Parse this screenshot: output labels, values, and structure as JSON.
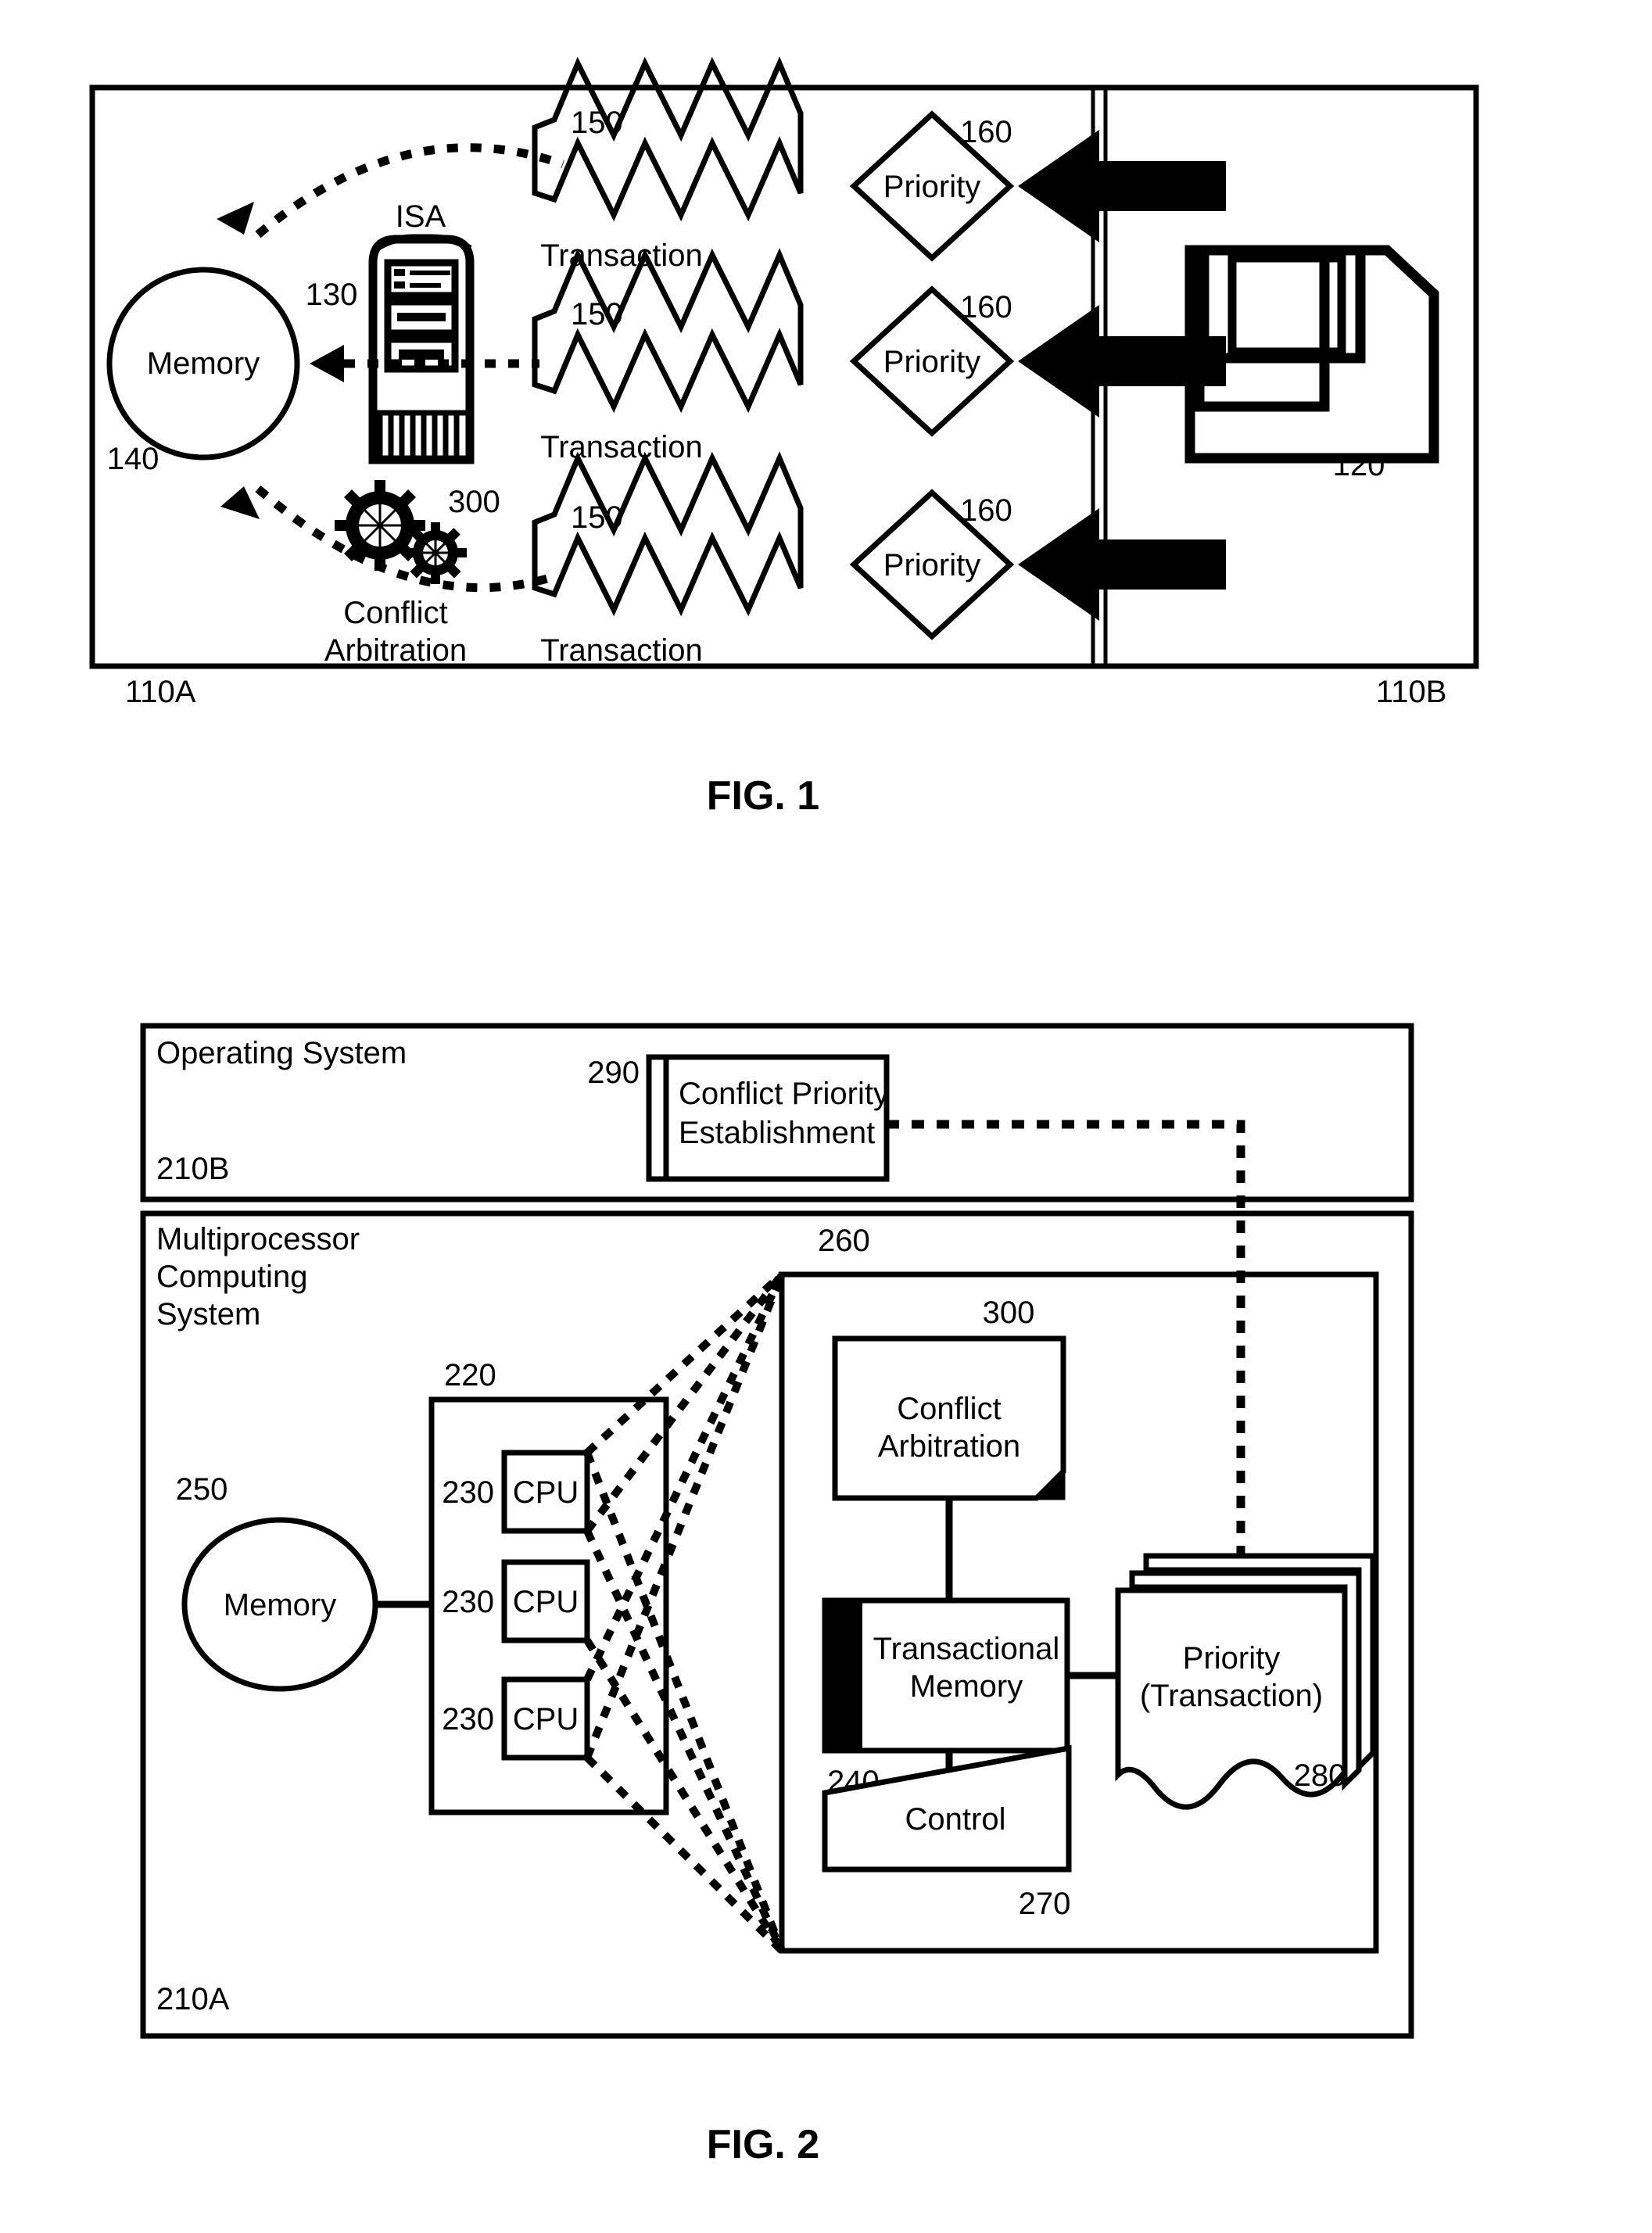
{
  "figures": [
    {
      "id": "fig1",
      "caption": "FIG. 1",
      "left_panel_ref": "110A",
      "right_panel_ref": "110B",
      "nodes": {
        "memory": {
          "label": "Memory",
          "ref": "140"
        },
        "isa": {
          "label": "ISA",
          "ref": "130"
        },
        "conflict_arbitration": {
          "label_line1": "Conflict",
          "label_line2": "Arbitration",
          "ref": "300"
        },
        "storage": {
          "ref": "120",
          "icon": "floppy-disk-icon"
        }
      },
      "rows": [
        {
          "transaction_label": "Transaction",
          "transaction_ref": "150",
          "priority_label": "Priority",
          "priority_ref": "160"
        },
        {
          "transaction_label": "Transaction",
          "transaction_ref": "150",
          "priority_label": "Priority",
          "priority_ref": "160"
        },
        {
          "transaction_label": "Transaction",
          "transaction_ref": "150",
          "priority_label": "Priority",
          "priority_ref": "160"
        }
      ]
    },
    {
      "id": "fig2",
      "caption": "FIG. 2",
      "os_panel": {
        "title": "Operating System",
        "ref": "210B"
      },
      "conflict_priority_establishment": {
        "line1": "Conflict Priority",
        "line2": "Establishment",
        "ref": "290"
      },
      "mp_panel": {
        "title_line1": "Multiprocessor",
        "title_line2": "Computing",
        "title_line3": "System",
        "ref": "210A"
      },
      "memory": {
        "label": "Memory",
        "ref": "250"
      },
      "cpu_group": {
        "ref": "220",
        "cpus": [
          {
            "label": "CPU",
            "ref": "230"
          },
          {
            "label": "CPU",
            "ref": "230"
          },
          {
            "label": "CPU",
            "ref": "230"
          }
        ]
      },
      "tm_panel": {
        "ref": "260"
      },
      "conflict_arbitration": {
        "line1": "Conflict",
        "line2": "Arbitration",
        "ref": "300"
      },
      "transactional_memory": {
        "line1": "Transactional",
        "line2": "Memory",
        "ref": "240"
      },
      "priority_docs": {
        "line1": "Priority",
        "line2": "(Transaction)",
        "ref": "280"
      },
      "control": {
        "label": "Control",
        "ref": "270"
      }
    }
  ]
}
